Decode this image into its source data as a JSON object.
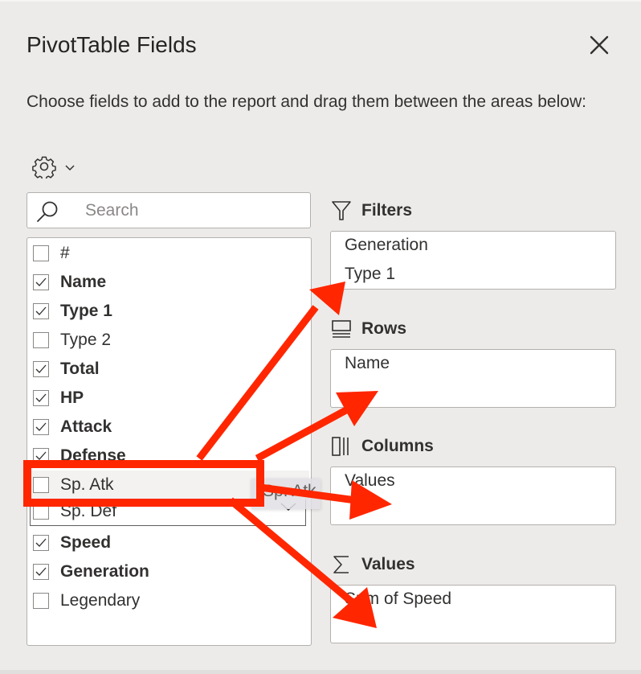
{
  "panel": {
    "title": "PivotTable Fields",
    "close_icon": "close-icon",
    "description": "Choose fields to add to the report and drag them between the areas below:",
    "settings_icon": "gear-icon",
    "settings_dropdown_icon": "chevron-down-icon"
  },
  "search": {
    "placeholder": "Search",
    "value": "",
    "icon": "search-icon"
  },
  "fields": [
    {
      "label": "#",
      "checked": false
    },
    {
      "label": "Name",
      "checked": true
    },
    {
      "label": "Type 1",
      "checked": true
    },
    {
      "label": "Type 2",
      "checked": false
    },
    {
      "label": "Total",
      "checked": true
    },
    {
      "label": "HP",
      "checked": true
    },
    {
      "label": "Attack",
      "checked": true
    },
    {
      "label": "Defense",
      "checked": true
    },
    {
      "label": "Sp. Atk",
      "checked": false,
      "state": "dragging"
    },
    {
      "label": "Sp. Def",
      "checked": false,
      "state": "focused"
    },
    {
      "label": "Speed",
      "checked": true
    },
    {
      "label": "Generation",
      "checked": true
    },
    {
      "label": "Legendary",
      "checked": false
    }
  ],
  "drag_ghost": {
    "label": "Sp. Atk"
  },
  "areas": {
    "filters": {
      "label": "Filters",
      "icon": "filter-icon",
      "items": [
        "Generation",
        "Type 1"
      ]
    },
    "rows": {
      "label": "Rows",
      "icon": "rows-icon",
      "items": [
        "Name"
      ]
    },
    "columns": {
      "label": "Columns",
      "icon": "columns-icon",
      "items": [
        "Values"
      ]
    },
    "values": {
      "label": "Values",
      "icon": "sigma-icon",
      "items": [
        "Sum of Speed"
      ]
    }
  },
  "annotation": {
    "color": "#ff2600",
    "highlighted_field": "Sp. Atk",
    "arrow_targets": [
      "Filters",
      "Rows",
      "Columns",
      "Values"
    ]
  }
}
